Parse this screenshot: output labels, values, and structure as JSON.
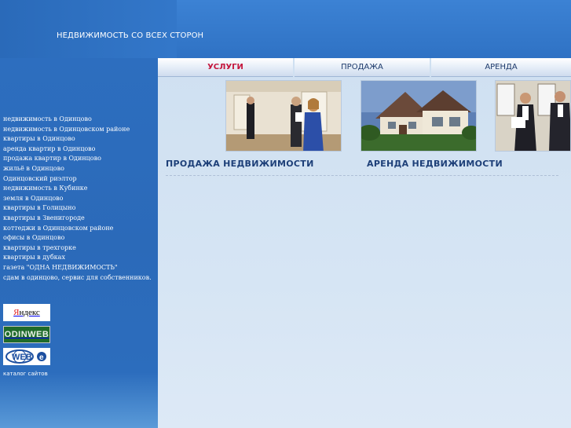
{
  "header": {
    "title": "НЕДВИЖИМОСТЬ СО ВСЕХ СТОРОН"
  },
  "tabs": [
    {
      "label": "УСЛУГИ",
      "active": true
    },
    {
      "label": "ПРОДАЖА",
      "active": false
    },
    {
      "label": "АРЕНДА",
      "active": false
    }
  ],
  "sidebar": {
    "links": [
      "недвижимость в Одинцово",
      "недвижимость в Одинцовском районе",
      "квартиры в Одинцово",
      "аренда квартир в Одинцово",
      "продажа квартир в Одинцово",
      "жильё в Одинцово",
      "Одинцовский риэлтор",
      "недвижимость в Кубинке",
      "земля в Одинцово",
      "квартиры в Голицыно",
      "квартиры в Звенигороде",
      "коттеджи в Одинцовском районе",
      "офисы в Одинцово",
      "квартиры в трехгорке",
      "квартиры в дубках",
      "газета \"ОДНА НЕДВИЖИМОСТЬ\"",
      "сдам в одинцово, сервис для собственников."
    ],
    "badges": {
      "yandex": "Яндекс",
      "odinweb": "ODINWEB",
      "webe": "WEB e"
    },
    "catalog_label": "каталог сайтов"
  },
  "main": {
    "heading_sales": "ПРОДАЖА НЕДВИЖИМОСТИ",
    "heading_rent": "АРЕНДА НЕДВИЖИМОСТИ"
  },
  "colors": {
    "brand_blue": "#2b6cbb",
    "active_tab": "#c4163c",
    "heading": "#1d3f78"
  }
}
